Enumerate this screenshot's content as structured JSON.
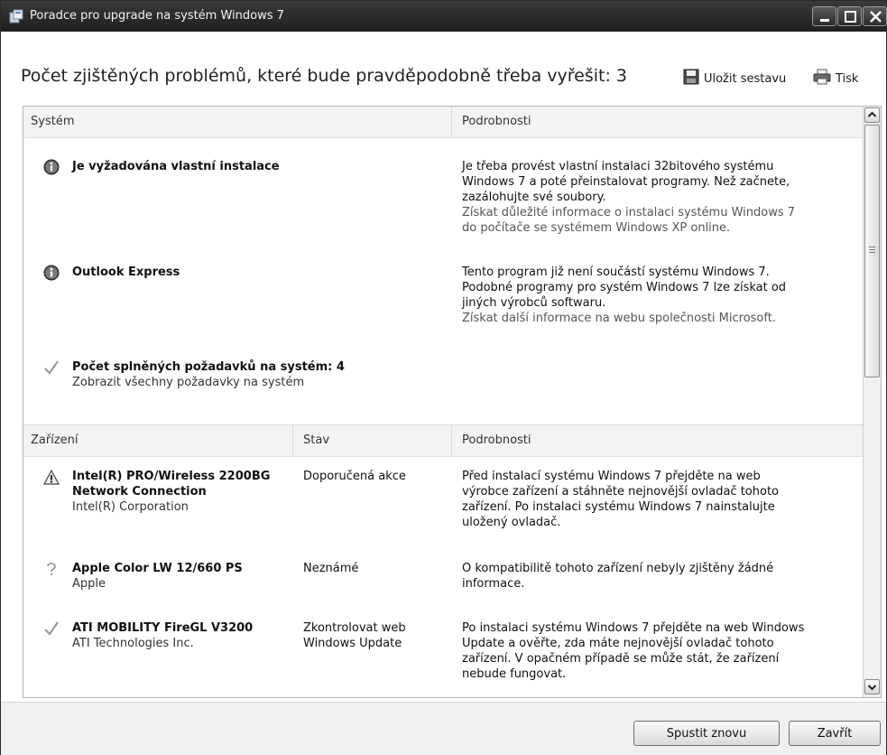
{
  "window": {
    "title": "Poradce pro upgrade na systém Windows 7"
  },
  "header": {
    "summary": "Počet zjištěných problémů, které bude pravděpodobně třeba vyřešit: 3",
    "save_label": "Uložit sestavu",
    "print_label": "Tisk"
  },
  "system_section": {
    "col_system": "Systém",
    "col_details": "Podrobnosti",
    "items": [
      {
        "icon": "info-icon",
        "title": "Je vyžadována vlastní instalace",
        "details": "Je třeba provést vlastní instalaci 32bitového systému Windows 7 a poté přeinstalovat programy. Než začnete, zazálohujte své soubory.",
        "link": "Získat důležité informace o instalaci systému Windows 7 do počítače se systémem Windows XP online."
      },
      {
        "icon": "info-icon",
        "title": "Outlook Express",
        "details": "Tento program již není součástí systému Windows 7. Podobné programy pro systém Windows 7 lze získat od jiných výrobců softwaru.",
        "link": "Získat další informace na webu společnosti Microsoft."
      }
    ],
    "passed": {
      "icon": "checkmark-icon",
      "title": "Počet splněných požadavků na systém: 4",
      "link": "Zobrazit všechny požadavky na systém"
    }
  },
  "device_section": {
    "col_device": "Zařízení",
    "col_status": "Stav",
    "col_details": "Podrobnosti",
    "items": [
      {
        "icon": "warning-icon",
        "title_line1": "Intel(R) PRO/Wireless 2200BG",
        "title_line2": "Network Connection",
        "vendor": "Intel(R) Corporation",
        "status": "Doporučená akce",
        "details": "Před instalací systému Windows 7 přejděte na web výrobce zařízení a stáhněte nejnovější ovladač tohoto zařízení. Po instalaci systému Windows 7 nainstalujte uložený ovladač."
      },
      {
        "icon": "question-icon",
        "title_line1": "Apple Color LW 12/660 PS",
        "vendor": "Apple",
        "status": "Neznámé",
        "details": "O kompatibilitě tohoto zařízení nebyly zjištěny žádné informace."
      },
      {
        "icon": "checkmark-icon",
        "title_line1": "ATI MOBILITY FireGL V3200",
        "vendor": "ATI Technologies Inc.",
        "status_line1": "Zkontrolovat web",
        "status_line2": "Windows Update",
        "details": "Po instalaci systému Windows 7 přejděte na web Windows Update a ověřte, zda máte nejnovější ovladač tohoto zařízení. V opačném případě se může stát, že zařízení nebude fungovat."
      }
    ]
  },
  "footer": {
    "restart_label": "Spustit znovu",
    "close_label": "Zavřít"
  }
}
